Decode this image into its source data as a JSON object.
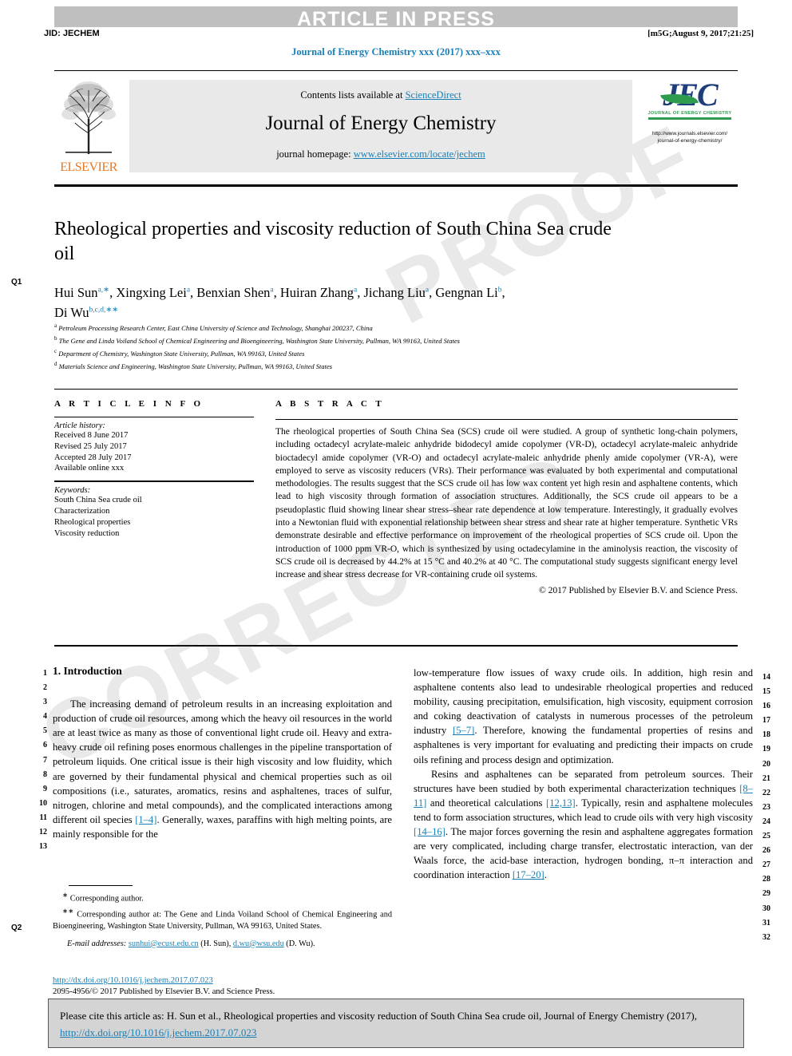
{
  "header": {
    "press_banner": "ARTICLE IN PRESS",
    "jid": "JID: JECHEM",
    "stamp": "[m5G;August 9, 2017;21:25]",
    "running_head": "Journal of Energy Chemistry xxx (2017) xxx–xxx"
  },
  "masthead": {
    "contents_prefix": "Contents lists available at ",
    "contents_link": "ScienceDirect",
    "journal_title": "Journal of Energy Chemistry",
    "homepage_prefix": "journal homepage: ",
    "homepage_link": "www.elsevier.com/locate/jechem",
    "publisher_wordmark": "ELSEVIER",
    "jec_mark": "JEC",
    "jec_subtitle": "JOURNAL OF ENERGY CHEMISTRY",
    "jec_url_line1": "http://www.journals.elsevier.com/",
    "jec_url_line2": "journal-of-energy-chemistry/"
  },
  "article": {
    "title": "Rheological properties and viscosity reduction of South China Sea crude oil",
    "authors_line1_parts": [
      {
        "name": "Hui Sun",
        "sup": "a,∗",
        "sep": ", "
      },
      {
        "name": "Xingxing Lei",
        "sup": "a",
        "sep": ", "
      },
      {
        "name": "Benxian Shen",
        "sup": "a",
        "sep": ", "
      },
      {
        "name": "Huiran Zhang",
        "sup": "a",
        "sep": ", "
      },
      {
        "name": "Jichang Liu",
        "sup": "a",
        "sep": ", "
      },
      {
        "name": "Gengnan Li",
        "sup": "b",
        "sep": ","
      }
    ],
    "authors_line2_parts": [
      {
        "name": "Di Wu",
        "sup": "b,c,d,∗∗",
        "sep": ""
      }
    ],
    "affiliations": [
      {
        "mark": "a",
        "text": "Petroleum Processing Research Center, East China University of Science and Technology, Shanghai 200237, China"
      },
      {
        "mark": "b",
        "text": "The Gene and Linda Voiland School of Chemical Engineering and Bioengineering, Washington State University, Pullman, WA 99163, United States"
      },
      {
        "mark": "c",
        "text": "Department of Chemistry, Washington State University, Pullman, WA 99163, United States"
      },
      {
        "mark": "d",
        "text": "Materials Science and Engineering, Washington State University, Pullman, WA 99163, United States"
      }
    ]
  },
  "article_info": {
    "heading": "A R T I C L E  I N F O",
    "history_label": "Article history:",
    "history": [
      "Received 8 June 2017",
      "Revised 25 July 2017",
      "Accepted 28 July 2017",
      "Available online xxx"
    ],
    "keywords_label": "Keywords:",
    "keywords": [
      "South China Sea crude oil",
      "Characterization",
      "Rheological properties",
      "Viscosity reduction"
    ]
  },
  "abstract": {
    "heading": "A B S T R A C T",
    "text": "The rheological properties of South China Sea (SCS) crude oil were studied. A group of synthetic long-chain polymers, including octadecyl acrylate-maleic anhydride bidodecyl amide copolymer (VR-D), octadecyl acrylate-maleic anhydride bioctadecyl amide copolymer (VR-O) and octadecyl acrylate-maleic anhydride phenly amide copolymer (VR-A), were employed to serve as viscosity reducers (VRs). Their performance was evaluated by both experimental and computational methodologies. The results suggest that the SCS crude oil has low wax content yet high resin and asphaltene contents, which lead to high viscosity through formation of association structures. Additionally, the SCS crude oil appears to be a pseudoplastic fluid showing linear shear stress–shear rate dependence at low temperature. Interestingly, it gradually evolves into a Newtonian fluid with exponential relationship between shear stress and shear rate at higher temperature. Synthetic VRs demonstrate desirable and effective performance on improvement of the rheological properties of SCS crude oil. Upon the introduction of 1000 ppm VR-O, which is synthesized by using octadecylamine in the aminolysis reaction, the viscosity of SCS crude oil is decreased by 44.2% at 15 °C and 40.2% at 40 °C. The computational study suggests significant energy level increase and shear stress decrease for VR-containing crude oil systems.",
    "copyright": "© 2017 Published by Elsevier B.V. and Science Press."
  },
  "body": {
    "section_heading": "1. Introduction",
    "left_paragraph": "The increasing demand of petroleum results in an increasing exploitation and production of crude oil resources, among which the heavy oil resources in the world are at least twice as many as those of conventional light crude oil. Heavy and extra-heavy crude oil refining poses enormous challenges in the pipeline transportation of petroleum liquids. One critical issue is their high viscosity and low fluidity, which are governed by their fundamental physical and chemical properties such as oil compositions (i.e., saturates, aromatics, resins and asphaltenes, traces of sulfur, nitrogen, chlorine and metal compounds), and the complicated interactions among different oil species",
    "left_ref": "[1–4]",
    "left_paragraph_tail": ". Generally, waxes, paraffins with high melting points, are mainly responsible for the",
    "right_para1_a": "low-temperature flow issues of waxy crude oils. In addition, high resin and asphaltene contents also lead to undesirable rheological properties and reduced mobility, causing precipitation, emulsification, high viscosity, equipment corrosion and coking deactivation of catalysts in numerous processes of the petroleum industry ",
    "right_para1_ref": "[5–7]",
    "right_para1_b": ". Therefore, knowing the fundamental properties of resins and asphaltenes is very important for evaluating and predicting their impacts on crude oils refining and process design and optimization.",
    "right_para2_a": "Resins and asphaltenes can be separated from petroleum sources. Their structures have been studied by both experimental characterization techniques ",
    "right_para2_ref1": "[8–11]",
    "right_para2_b": " and theoretical calculations ",
    "right_para2_ref2": "[12,13]",
    "right_para2_c": ". Typically, resin and asphaltene molecules tend to form association structures, which lead to crude oils with very high viscosity ",
    "right_para2_ref3": "[14–16]",
    "right_para2_d": ". The major forces governing the resin and asphaltene aggregates formation are very complicated, including charge transfer, electrostatic interaction, van der Waals force, the acid-base interaction, hydrogen bonding, π–π interaction and coordination interaction ",
    "right_para2_ref4": "[17–20]",
    "right_para2_e": "."
  },
  "line_numbers": {
    "left": [
      "1",
      "2",
      "3",
      "4",
      "5",
      "6",
      "7",
      "8",
      "9",
      "10",
      "11",
      "12",
      "13"
    ],
    "right": [
      "14",
      "15",
      "16",
      "17",
      "18",
      "19",
      "20",
      "21",
      "22",
      "23",
      "24",
      "25",
      "26",
      "27",
      "28",
      "29",
      "30",
      "31",
      "32"
    ]
  },
  "query_markers": {
    "q1": "Q1",
    "q2": "Q2"
  },
  "footnotes": {
    "item1_mark": "∗",
    "item1": " Corresponding author.",
    "item2_mark": "∗∗",
    "item2": " Corresponding author at: The Gene and Linda Voiland School of Chemical Engineering and Bioengineering, Washington State University, Pullman, WA 99163, United States.",
    "email_label": "E-mail addresses:",
    "email1": "sunhui@ecust.edu.cn",
    "email1_owner": " (H. Sun), ",
    "email2": "d.wu@wsu.edu",
    "email2_owner": " (D. Wu)."
  },
  "doi_block": {
    "doi": "http://dx.doi.org/10.1016/j.jechem.2017.07.023",
    "issn_line": "2095-4956/© 2017 Published by Elsevier B.V. and Science Press."
  },
  "cite_box": {
    "prefix": "Please cite this article as: H. Sun et al., Rheological properties and viscosity reduction of South China Sea crude oil, Journal of Energy Chemistry (2017), ",
    "link": "http://dx.doi.org/10.1016/j.jechem.2017.07.023"
  },
  "watermark": {
    "word1": "PROOF",
    "word2": "CORRECTED"
  },
  "colors": {
    "link": "#1a7fb5",
    "banner": "#bfbfbf",
    "elsevier_orange": "#e87722",
    "jec_blue": "#1f3d7a",
    "jec_green": "#2e9b4e"
  }
}
